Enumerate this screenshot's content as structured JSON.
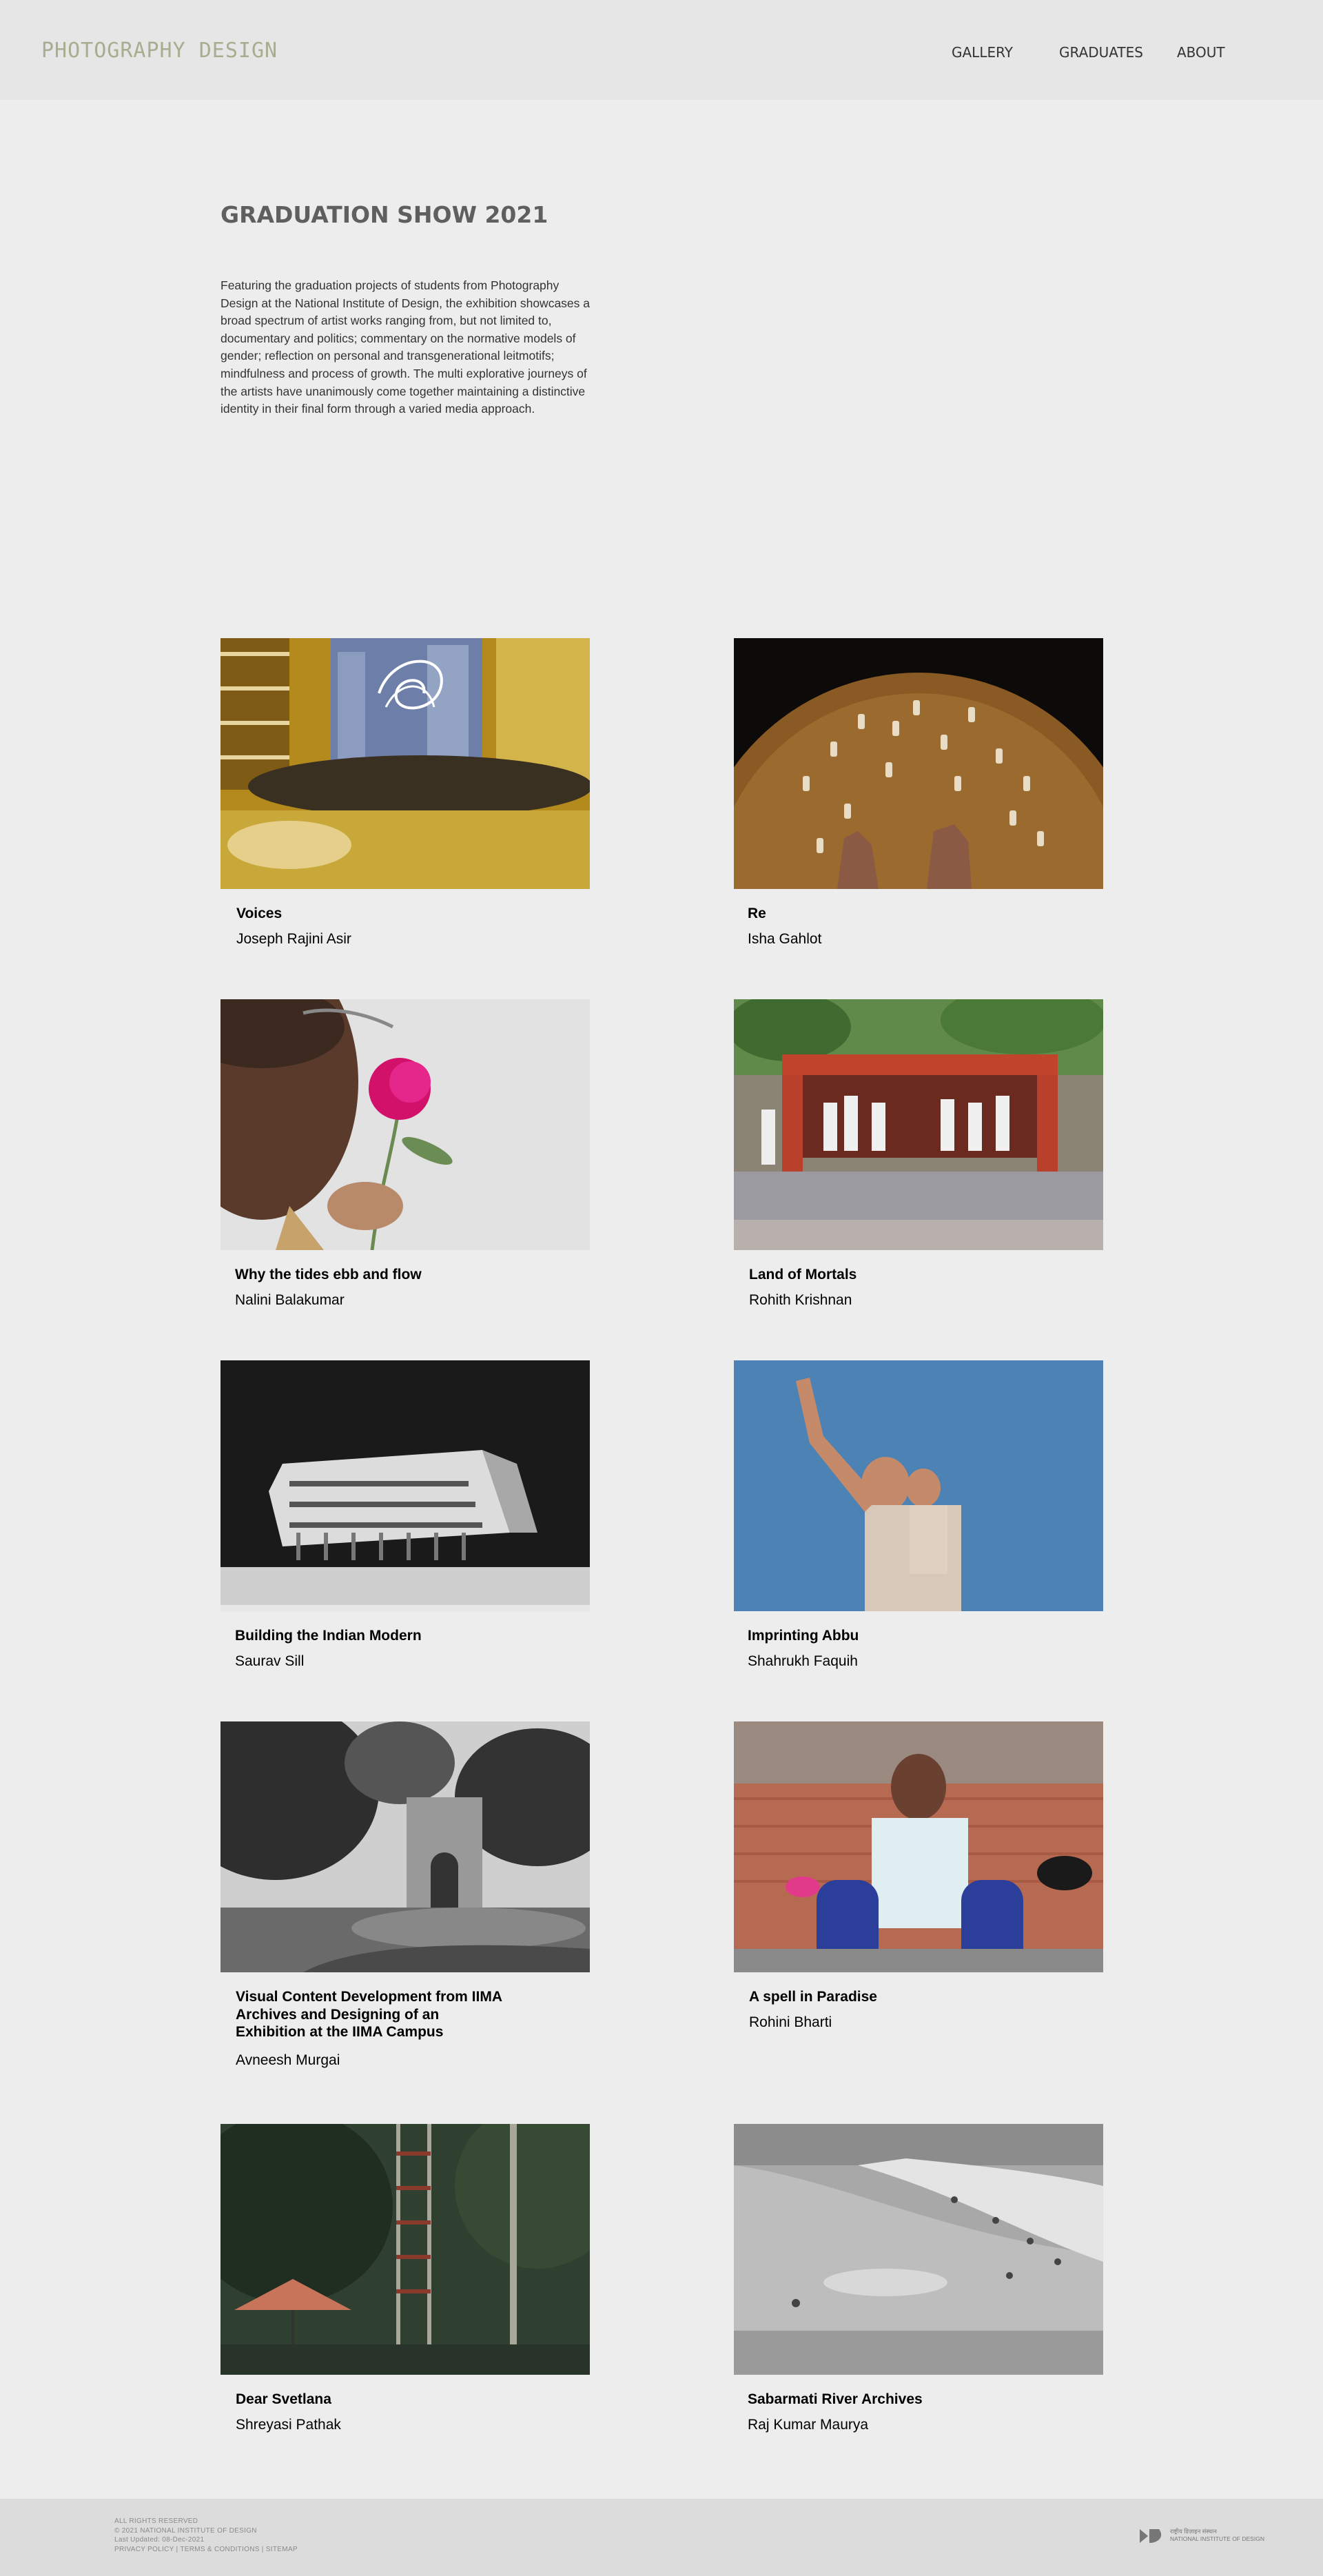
{
  "header": {
    "logo": "PHOTOGRAPHY DESIGN",
    "nav": {
      "gallery": "GALLERY",
      "graduates": "GRADUATES",
      "about": "ABOUT"
    }
  },
  "intro": {
    "title": "GRADUATION SHOW 2021",
    "text": "Featuring the graduation projects of students from Photography Design at the National Institute of Design, the exhibition showcases a broad spectrum of artist works ranging from, but not limited to, documentary and politics; commentary on the normative models of gender; reflection on personal and transgenerational leitmotifs; mindfulness and process of growth. The multi explorative journeys of the artists have unanimously come together maintaining a distinctive identity in their final form through a varied media approach."
  },
  "projects": [
    {
      "title": "Voices",
      "author": "Joseph Rajini Asir"
    },
    {
      "title": "Re",
      "author": "Isha Gahlot"
    },
    {
      "title": "Why the tides ebb and flow",
      "author": "Nalini Balakumar"
    },
    {
      "title": "Land of Mortals",
      "author": "Rohith Krishnan"
    },
    {
      "title": "Building the Indian Modern",
      "author": "Saurav Sill"
    },
    {
      "title": "Imprinting Abbu",
      "author": "Shahrukh Faquih"
    },
    {
      "title": "Visual Content Development from IIMA Archives and Designing of an Exhibition at the IIMA Campus",
      "author": "Avneesh Murgai"
    },
    {
      "title": "A spell in Paradise",
      "author": "Rohini Bharti"
    },
    {
      "title": "Dear Svetlana",
      "author": "Shreyasi Pathak"
    },
    {
      "title": "Sabarmati River Archives",
      "author": "Raj Kumar Maurya"
    }
  ],
  "footer": {
    "rights": "ALL RIGHTS RESERVED",
    "copyright": "© 2021 NATIONAL INSTITUTE OF DESIGN",
    "updated": "Last Updated: 08-Dec-2021",
    "links": "PRIVACY POLICY | TERMS & CONDITIONS | SITEMAP",
    "nid_line1": "राष्ट्रीय डिज़ाइन संस्थान",
    "nid_line2": "NATIONAL INSTITUTE OF DESIGN"
  }
}
